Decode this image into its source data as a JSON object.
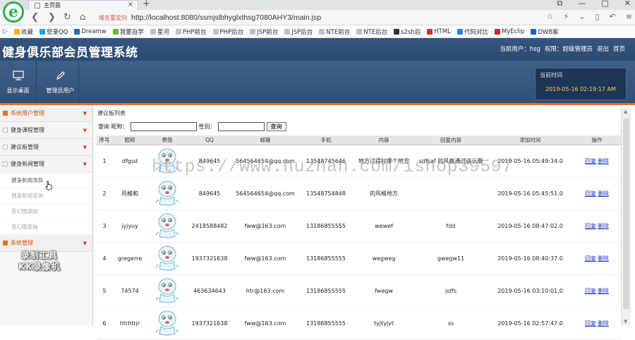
{
  "browser": {
    "logo_letter": "e",
    "tab_title": "主页面",
    "tab_close": "×",
    "new_tab": "+",
    "address_badge": "域名重定向",
    "url": "http://localhost:8080/ssmjslbhyglxthsg7080AHY3/main.jsp",
    "bookmarks": [
      {
        "label": "收藏",
        "color": "#f0b400"
      },
      {
        "label": "登录QQ",
        "color": "#1da1f2"
      },
      {
        "label": "Dreamw",
        "color": "#2a6ab0"
      },
      {
        "label": "我要自学",
        "color": "#77aa33"
      },
      {
        "label": "星河",
        "color": "#c0c0c0"
      },
      {
        "label": "PHP前台",
        "color": "#c0c0c0"
      },
      {
        "label": "PHP后台",
        "color": "#c0c0c0"
      },
      {
        "label": "JSP前台",
        "color": "#c0c0c0"
      },
      {
        "label": "JSP后台",
        "color": "#c0c0c0"
      },
      {
        "label": "NTE前台",
        "color": "#c0c0c0"
      },
      {
        "label": "NTE后台",
        "color": "#c0c0c0"
      },
      {
        "label": "s2sh后",
        "color": "#333333"
      },
      {
        "label": "HTML",
        "color": "#d0312d"
      },
      {
        "label": "代码对比",
        "color": "#2979ff"
      },
      {
        "label": "MyEclip",
        "color": "#c62828"
      },
      {
        "label": "DW8案",
        "color": "#1565c0"
      }
    ]
  },
  "header": {
    "title": "健身俱乐部会员管理系统",
    "user_label": "当前用户：hsg",
    "role_label": "权限：超级管理员",
    "logout": "退出",
    "home": "首页"
  },
  "toolbar": {
    "desktop_label": "显示桌面",
    "admin_label": "管理员用户",
    "time_label": "当前时间",
    "time_value": "2019-05-16 02:19:17 AM"
  },
  "sidebar": {
    "group_system_users": "系统用户管理",
    "group_course": "健身课程管理",
    "group_suggest": "建议板管理",
    "group_news": "健身新闻管理",
    "sub_news_add": "健身新闻添加",
    "sub_news_query": "健身新闻查询",
    "sub_slide_add": "变幻图添加",
    "sub_slide_query": "变幻图查询",
    "group_system": "系统管理"
  },
  "main": {
    "panel_title": "建议板列表",
    "search_prefix": "查询 昵称：",
    "search_gender": "性别：",
    "search_button": "查询",
    "columns": [
      "序号",
      "昵称",
      "表情",
      "QQ",
      "邮箱",
      "手机",
      "内容",
      "回复内容",
      "添加时间",
      "操作"
    ],
    "rows": [
      {
        "no": "1",
        "nick": "dfgsd",
        "qq": "849645",
        "email": "564564654@qq.com",
        "phone": "13548745646",
        "content": "地方过得好哪个地方",
        "reply": "sdfsaf 的风格通过该认罪",
        "time": "2019-05-16 05:49:34.0"
      },
      {
        "no": "2",
        "nick": "风格和",
        "qq": "849645",
        "email": "564564654@qq.com",
        "phone": "13548754848",
        "content": "的风格地方",
        "reply": "",
        "time": "2019-05-16 05:45:51.0"
      },
      {
        "no": "3",
        "nick": "jyjyuy",
        "qq": "2418588482",
        "email": "fww@163.com",
        "phone": "13186855555",
        "content": "wewef",
        "reply": "fdd",
        "time": "2019-05-16 08:47:02.0"
      },
      {
        "no": "4",
        "nick": "gregerre",
        "qq": "1937321638",
        "email": "fww@163.com",
        "phone": "13186855555",
        "content": "wegweg",
        "reply": "gwegw11",
        "time": "2019-05-16 08:40:37.0"
      },
      {
        "no": "5",
        "nick": "74574",
        "qq": "463634643",
        "email": "htr@163.com",
        "phone": "13186855555",
        "content": "fwegw",
        "reply": "sdfs",
        "time": "2019-05-16 03:10:01.0"
      },
      {
        "no": "6",
        "nick": "htrhtrjr",
        "qq": "1937321638",
        "email": "fww@163.com",
        "phone": "13186855555",
        "content": "tyjtyjyt",
        "reply": "ss",
        "time": "2019-05-16 02:57:47.0"
      }
    ],
    "reply_link": "回复",
    "delete_link": "删除"
  },
  "overlay": {
    "watermark": "https://www.huzhan.com/ishop39597",
    "rec_line1": "录制工具",
    "rec_line2": "KK录像机"
  },
  "colors": {
    "header_bg": "#33517a",
    "accent_orange": "#e86f1a",
    "link_blue": "#1a37c8",
    "time_yellow": "#f4d03f"
  }
}
